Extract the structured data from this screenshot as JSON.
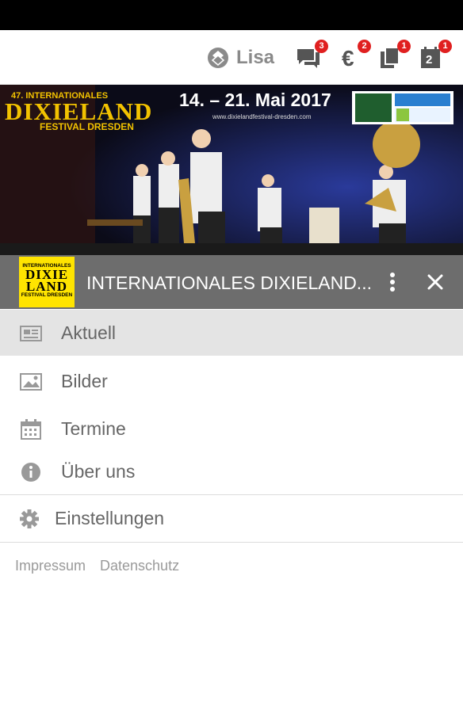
{
  "topbar": {
    "user_name": "Lisa",
    "badges": {
      "messages": "3",
      "payments": "2",
      "documents": "1",
      "calendar": "1"
    },
    "calendar_day": "2"
  },
  "banner": {
    "festival_prefix": "47. INTERNATIONALES",
    "festival_name": "DIXIELAND",
    "festival_suffix": "FESTIVAL DRESDEN",
    "dates": "14. – 21. Mai 2017",
    "url": "www.dixielandfestival-dresden.com"
  },
  "header": {
    "logo_line1": "INTERNATIONALES",
    "logo_line2": "DIXIE",
    "logo_line3": "LAND",
    "logo_line4": "FESTIVAL DRESDEN",
    "title": "INTERNATIONALES DIXIELAND..."
  },
  "menu": {
    "items": [
      {
        "label": "Aktuell",
        "icon": "newspaper-icon",
        "active": true
      },
      {
        "label": "Bilder",
        "icon": "image-icon",
        "active": false
      },
      {
        "label": "Termine",
        "icon": "calendar-icon",
        "active": false
      },
      {
        "label": "Über uns",
        "icon": "info-icon",
        "active": false
      }
    ],
    "settings_label": "Einstellungen"
  },
  "footer": {
    "impressum": "Impressum",
    "datenschutz": "Datenschutz"
  },
  "colors": {
    "badge": "#e02020",
    "header_bar": "#6d6d6d",
    "logo_yellow": "#ffe400",
    "active_row": "#e4e4e4"
  }
}
